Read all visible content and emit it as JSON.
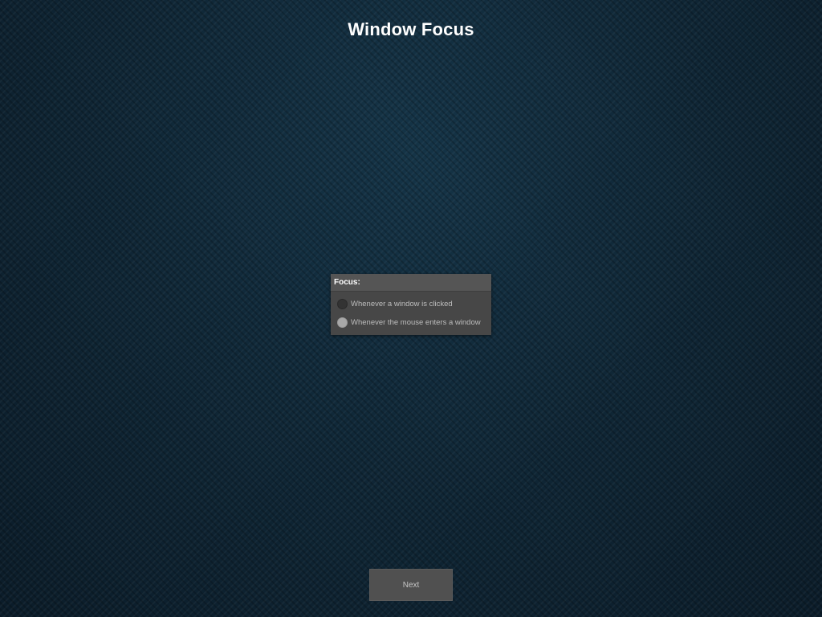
{
  "header": {
    "title": "Window Focus"
  },
  "focus_panel": {
    "title": "Focus:",
    "options": [
      {
        "label": "Whenever a window is clicked",
        "selected": false
      },
      {
        "label": "Whenever the mouse enters a window",
        "selected": true
      }
    ]
  },
  "footer": {
    "next_label": "Next"
  },
  "colors": {
    "background": "#10293a",
    "panel": "#474747",
    "panel_header": "#555555",
    "button": "#505050"
  }
}
